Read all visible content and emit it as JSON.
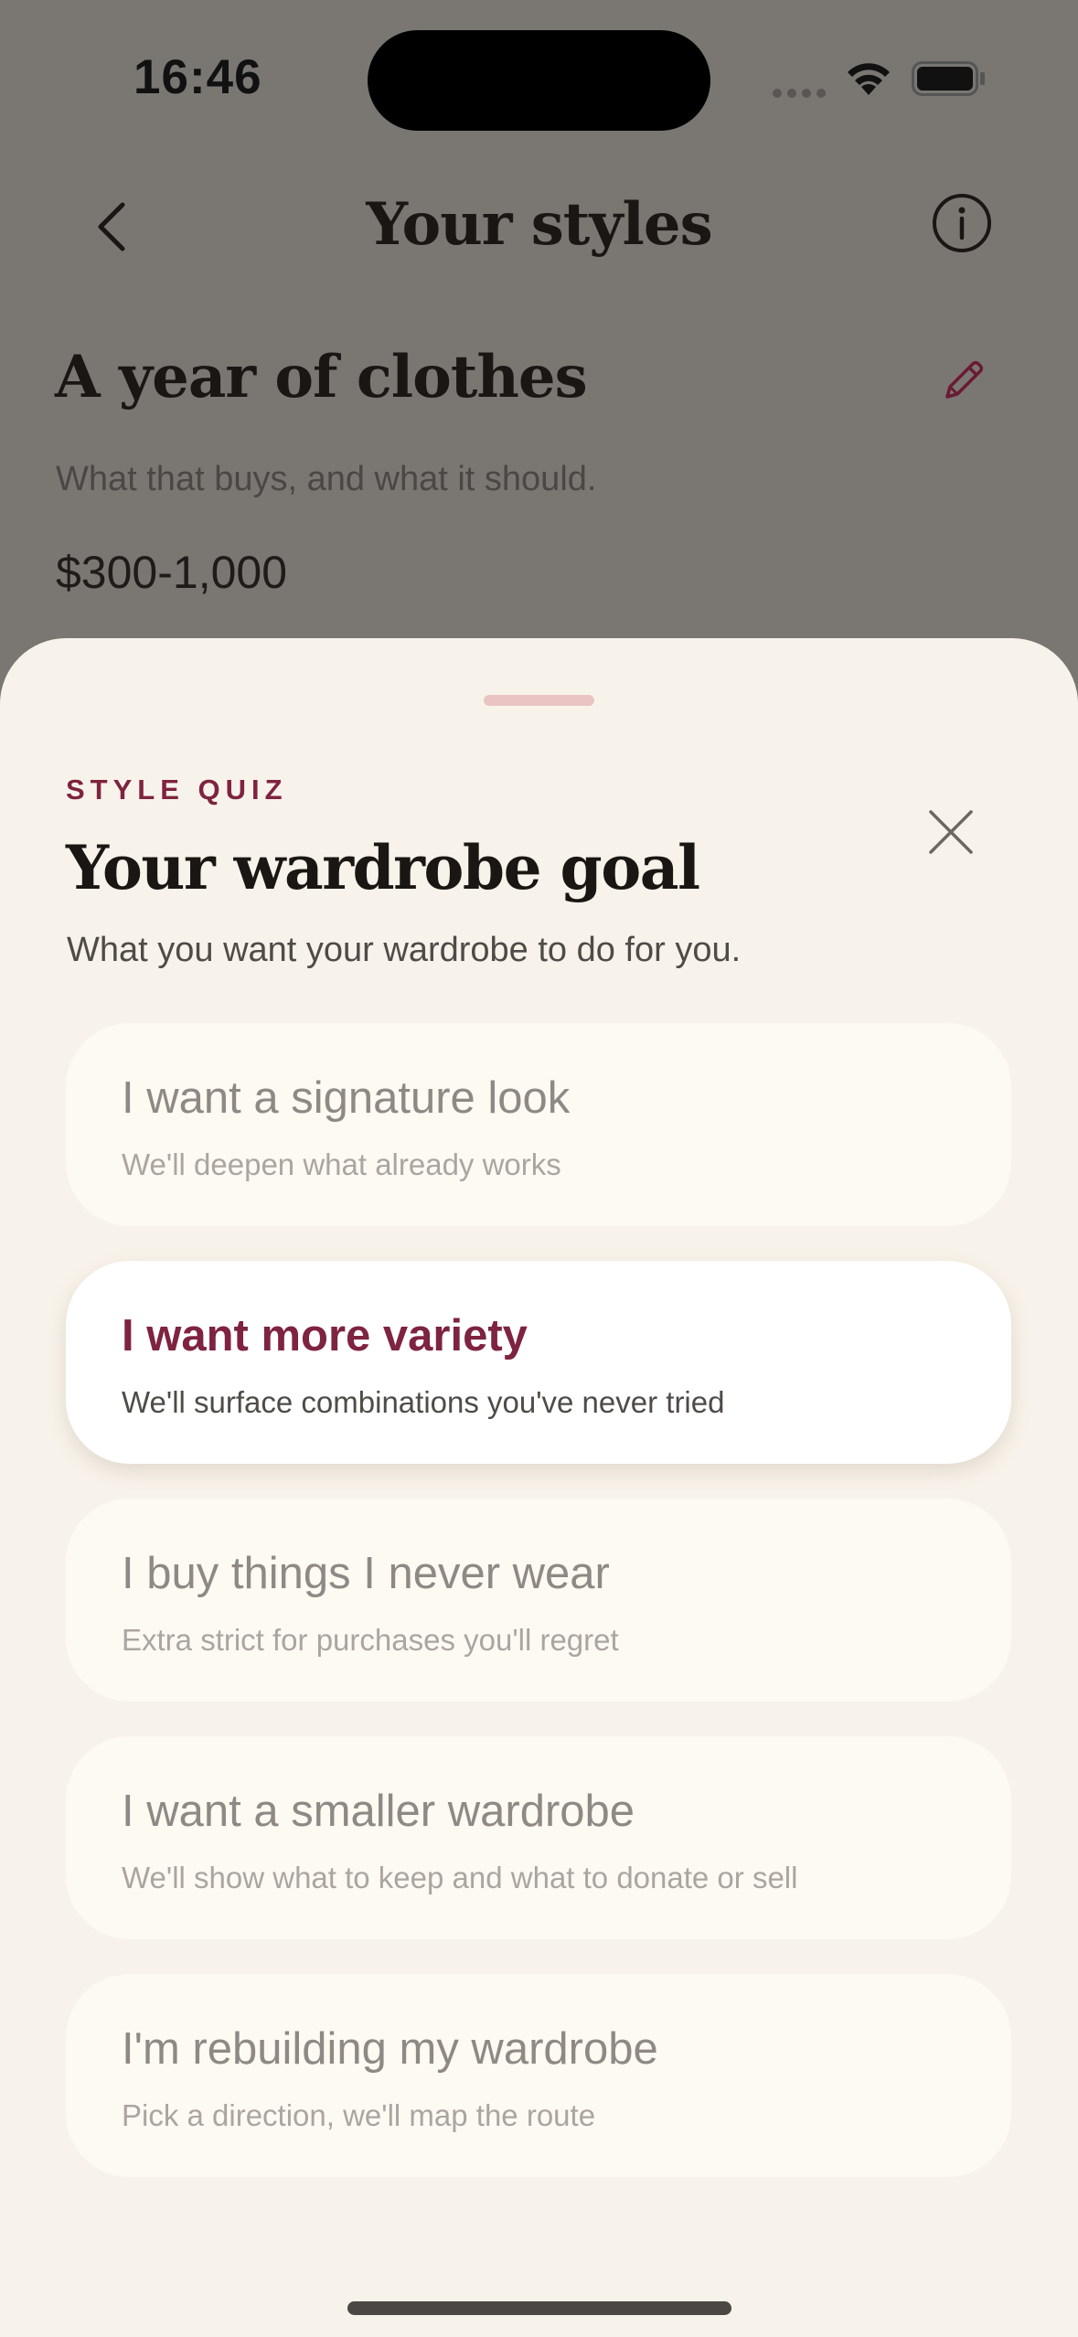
{
  "status_bar": {
    "time": "16:46"
  },
  "nav": {
    "title": "Your styles",
    "back_icon": "chevron-left-icon",
    "info_icon": "info-icon"
  },
  "section": {
    "title": "A year of clothes",
    "subtitle": "What that buys, and what it should.",
    "price": "$300-1,000",
    "edit_icon": "pencil-icon"
  },
  "sheet": {
    "eyebrow": "STYLE QUIZ",
    "title": "Your wardrobe goal",
    "subtitle": "What you want your wardrobe to do for you.",
    "options": [
      {
        "label": "I want a signature look",
        "description": "We'll deepen what already works",
        "selected": false
      },
      {
        "label": "I want more variety",
        "description": "We'll surface combinations you've never tried",
        "selected": true
      },
      {
        "label": "I buy things I never wear",
        "description": "Extra strict for purchases you'll regret",
        "selected": false
      },
      {
        "label": "I want a smaller wardrobe",
        "description": "We'll show what to keep and what to donate or sell",
        "selected": false
      },
      {
        "label": "I'm rebuilding my wardrobe",
        "description": "Pick a direction, we'll map the route",
        "selected": false
      }
    ]
  },
  "colors": {
    "accent": "#7e2340",
    "sheet_bg": "#f8f3ea",
    "overlay": "#7a7773",
    "handle": "#e9c4c3"
  }
}
